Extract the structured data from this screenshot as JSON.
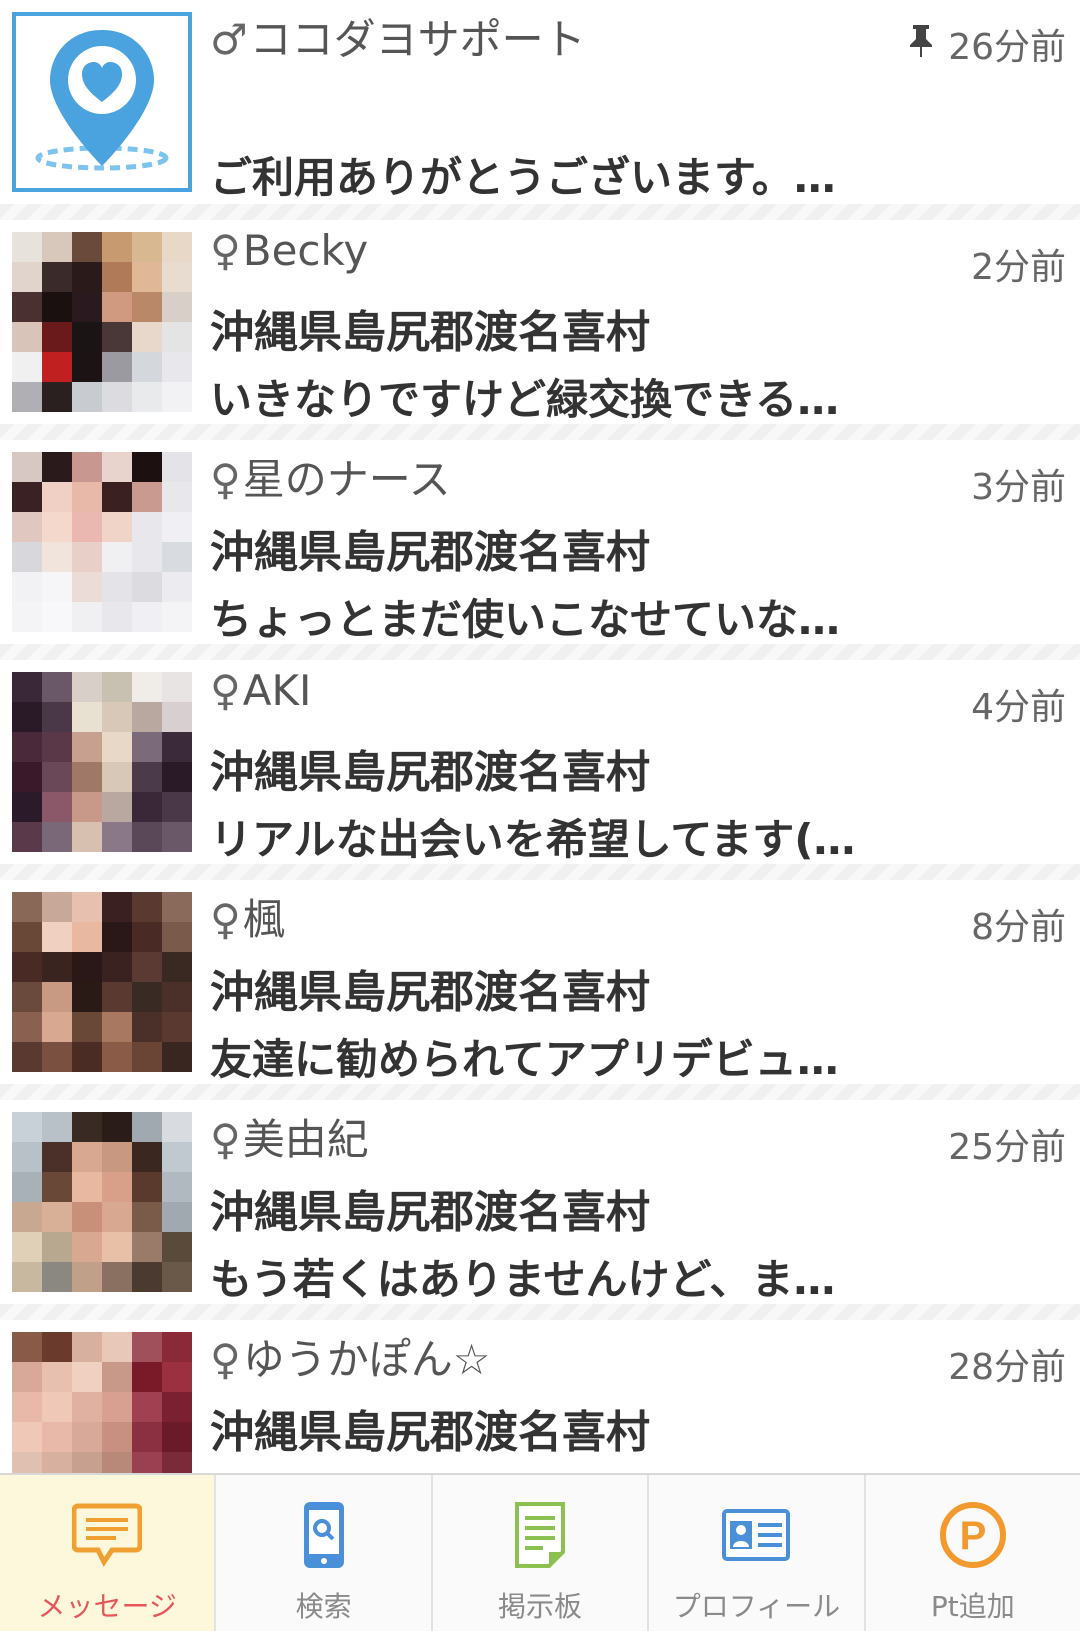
{
  "messages": [
    {
      "name_symbol": "♂",
      "name": "ココダヨサポート",
      "time": "26分前",
      "pinned": true,
      "location": "",
      "preview": "ご利用ありがとうございます。…",
      "avatar": "support-logo"
    },
    {
      "name_symbol": "♀",
      "name": "Becky",
      "time": "2分前",
      "location": "沖縄県島尻郡渡名喜村",
      "preview": "いきなりですけど緑交換できる…",
      "avatar": "mosaic-photo"
    },
    {
      "name_symbol": "♀",
      "name": "星のナース",
      "time": "3分前",
      "location": "沖縄県島尻郡渡名喜村",
      "preview": "ちょっとまだ使いこなせていな…",
      "avatar": "mosaic-photo"
    },
    {
      "name_symbol": "♀",
      "name": "AKI",
      "time": "4分前",
      "location": "沖縄県島尻郡渡名喜村",
      "preview": "リアルな出会いを希望してます(…",
      "avatar": "mosaic-photo"
    },
    {
      "name_symbol": "♀",
      "name": "楓",
      "time": "8分前",
      "location": "沖縄県島尻郡渡名喜村",
      "preview": "友達に勧められてアプリデビュ…",
      "avatar": "mosaic-photo"
    },
    {
      "name_symbol": "♀",
      "name": "美由紀",
      "time": "25分前",
      "location": "沖縄県島尻郡渡名喜村",
      "preview": "もう若くはありませんけど、ま…",
      "avatar": "mosaic-photo"
    },
    {
      "name_symbol": "♀",
      "name": "ゆうかぽん☆",
      "time": "28分前",
      "location": "沖縄県島尻郡渡名喜村",
      "preview": "",
      "avatar": "mosaic-photo"
    }
  ],
  "tabbar": {
    "tabs": [
      {
        "label": "メッセージ",
        "icon": "message-icon",
        "active": true
      },
      {
        "label": "検索",
        "icon": "phone-search-icon",
        "active": false
      },
      {
        "label": "掲示板",
        "icon": "board-icon",
        "active": false
      },
      {
        "label": "プロフィール",
        "icon": "profile-card-icon",
        "active": false
      },
      {
        "label": "Pt追加",
        "icon": "points-icon",
        "active": false
      }
    ]
  },
  "colors": {
    "active_tab_bg": "#fdf7dc",
    "active_tab_label": "#e8565c",
    "message_icon": "#f0a030",
    "search_icon": "#4a90d9",
    "board_icon": "#8cc152",
    "profile_icon": "#4a90d9",
    "points_icon": "#f29a2e",
    "support_pin": "#4aa3df"
  }
}
